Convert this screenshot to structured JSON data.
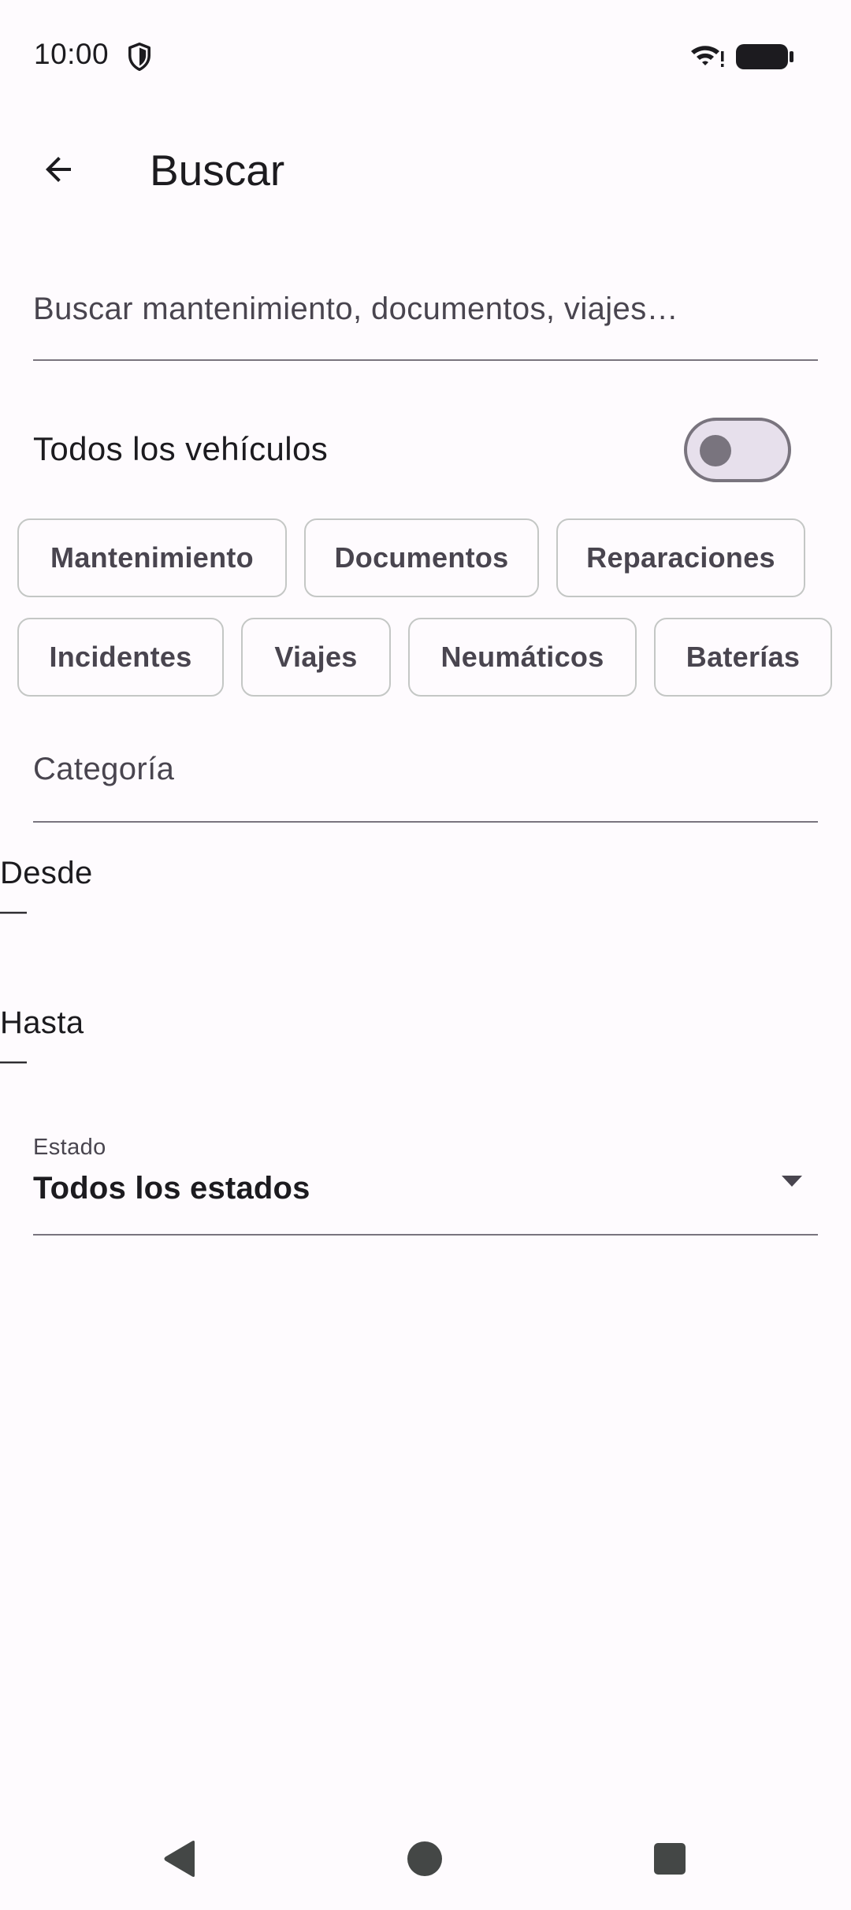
{
  "status_bar": {
    "time": "10:00",
    "icons": [
      "shield-icon",
      "wifi-icon",
      "battery-icon"
    ]
  },
  "app_bar": {
    "title": "Buscar",
    "back_icon": "arrow-back-icon"
  },
  "search": {
    "placeholder": "Buscar mantenimiento, documentos, viajes…",
    "value": ""
  },
  "vehicles_toggle": {
    "label": "Todos los vehículos",
    "on": false
  },
  "chips": {
    "row1": [
      "Mantenimiento",
      "Documentos",
      "Reparaciones"
    ],
    "row2": [
      "Incidentes",
      "Viajes",
      "Neumáticos",
      "Baterías"
    ]
  },
  "category": {
    "placeholder": "Categoría",
    "value": ""
  },
  "date_from": {
    "label": "Desde",
    "value": "—"
  },
  "date_to": {
    "label": "Hasta",
    "value": "—"
  },
  "status_select": {
    "label": "Estado",
    "value": "Todos los estados"
  },
  "colors": {
    "background": "#FEFBFE",
    "text": "#1C1B1F",
    "outline": "#79747E",
    "chip_border": "#C4C7C5",
    "switch_track": "#E7E0EC"
  },
  "nav_bar": {
    "icons": [
      "nav-back-icon",
      "nav-home-icon",
      "nav-recents-icon"
    ]
  }
}
